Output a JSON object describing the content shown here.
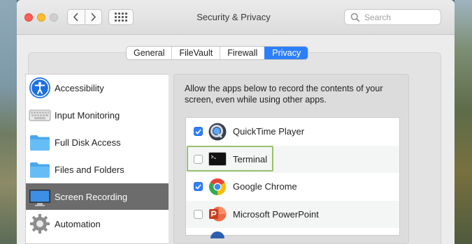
{
  "window": {
    "title": "Security & Privacy",
    "search_placeholder": "Search"
  },
  "tabs": [
    {
      "label": "General",
      "active": false
    },
    {
      "label": "FileVault",
      "active": false
    },
    {
      "label": "Firewall",
      "active": false
    },
    {
      "label": "Privacy",
      "active": true
    }
  ],
  "sidebar": {
    "items": [
      {
        "label": "Accessibility",
        "icon": "accessibility-icon"
      },
      {
        "label": "Input Monitoring",
        "icon": "keyboard-icon"
      },
      {
        "label": "Full Disk Access",
        "icon": "folder-icon"
      },
      {
        "label": "Files and Folders",
        "icon": "folder-icon"
      },
      {
        "label": "Screen Recording",
        "icon": "display-icon",
        "selected": true
      },
      {
        "label": "Automation",
        "icon": "gear-icon"
      }
    ]
  },
  "main": {
    "description": "Allow the apps below to record the contents of your screen, even while using other apps.",
    "apps": [
      {
        "name": "QuickTime Player",
        "checked": true,
        "icon": "quicktime-icon"
      },
      {
        "name": "Terminal",
        "checked": false,
        "icon": "terminal-icon"
      },
      {
        "name": "Google Chrome",
        "checked": true,
        "icon": "chrome-icon"
      },
      {
        "name": "Microsoft PowerPoint",
        "checked": false,
        "icon": "powerpoint-icon"
      }
    ]
  },
  "colors": {
    "accent": "#2d7ff9",
    "selection": "#6c6c6c",
    "highlight_box": "#97c16b"
  }
}
